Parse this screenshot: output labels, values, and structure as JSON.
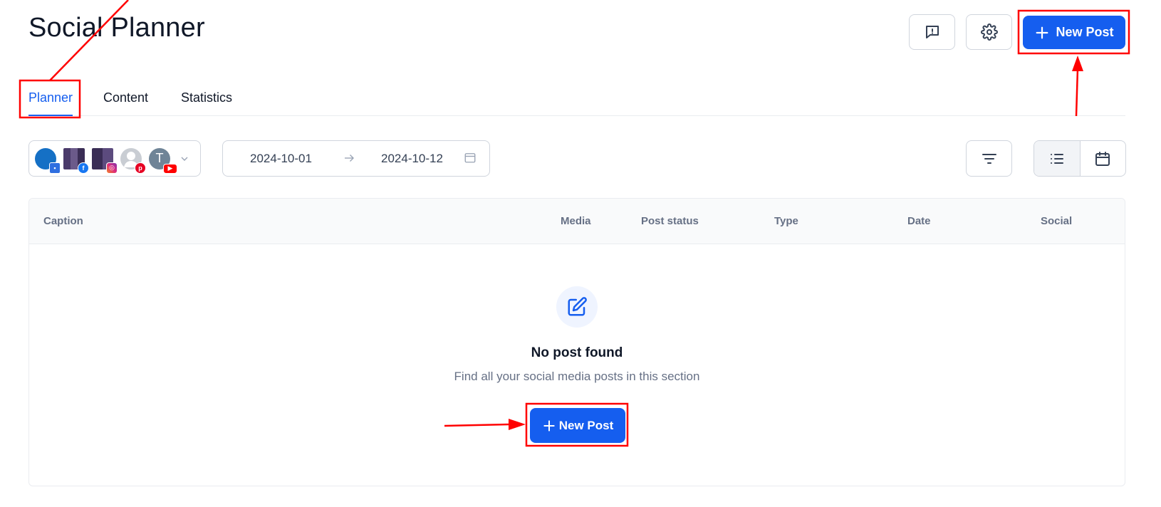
{
  "header": {
    "title": "Social Planner",
    "new_post_label": "New Post"
  },
  "tabs": [
    {
      "label": "Planner",
      "active": true
    },
    {
      "label": "Content",
      "active": false
    },
    {
      "label": "Statistics",
      "active": false
    }
  ],
  "accounts": {
    "avatars": [
      {
        "type": "image",
        "badge": "gmb-icon"
      },
      {
        "type": "image",
        "badge": "facebook-icon"
      },
      {
        "type": "image",
        "badge": "instagram-icon"
      },
      {
        "type": "placeholder",
        "badge": "pinterest-icon"
      },
      {
        "type": "letter",
        "letter": "T",
        "badge": "youtube-icon"
      }
    ]
  },
  "date_range": {
    "start": "2024-10-01",
    "end": "2024-10-12"
  },
  "table": {
    "columns": [
      "Caption",
      "Media",
      "Post status",
      "Type",
      "Date",
      "Social"
    ]
  },
  "empty_state": {
    "title": "No post found",
    "subtitle": "Find all your social media posts in this section",
    "button_label": "New Post"
  },
  "colors": {
    "primary": "#155eef",
    "annotation": "#ff0000",
    "border": "#d0d5dd"
  }
}
